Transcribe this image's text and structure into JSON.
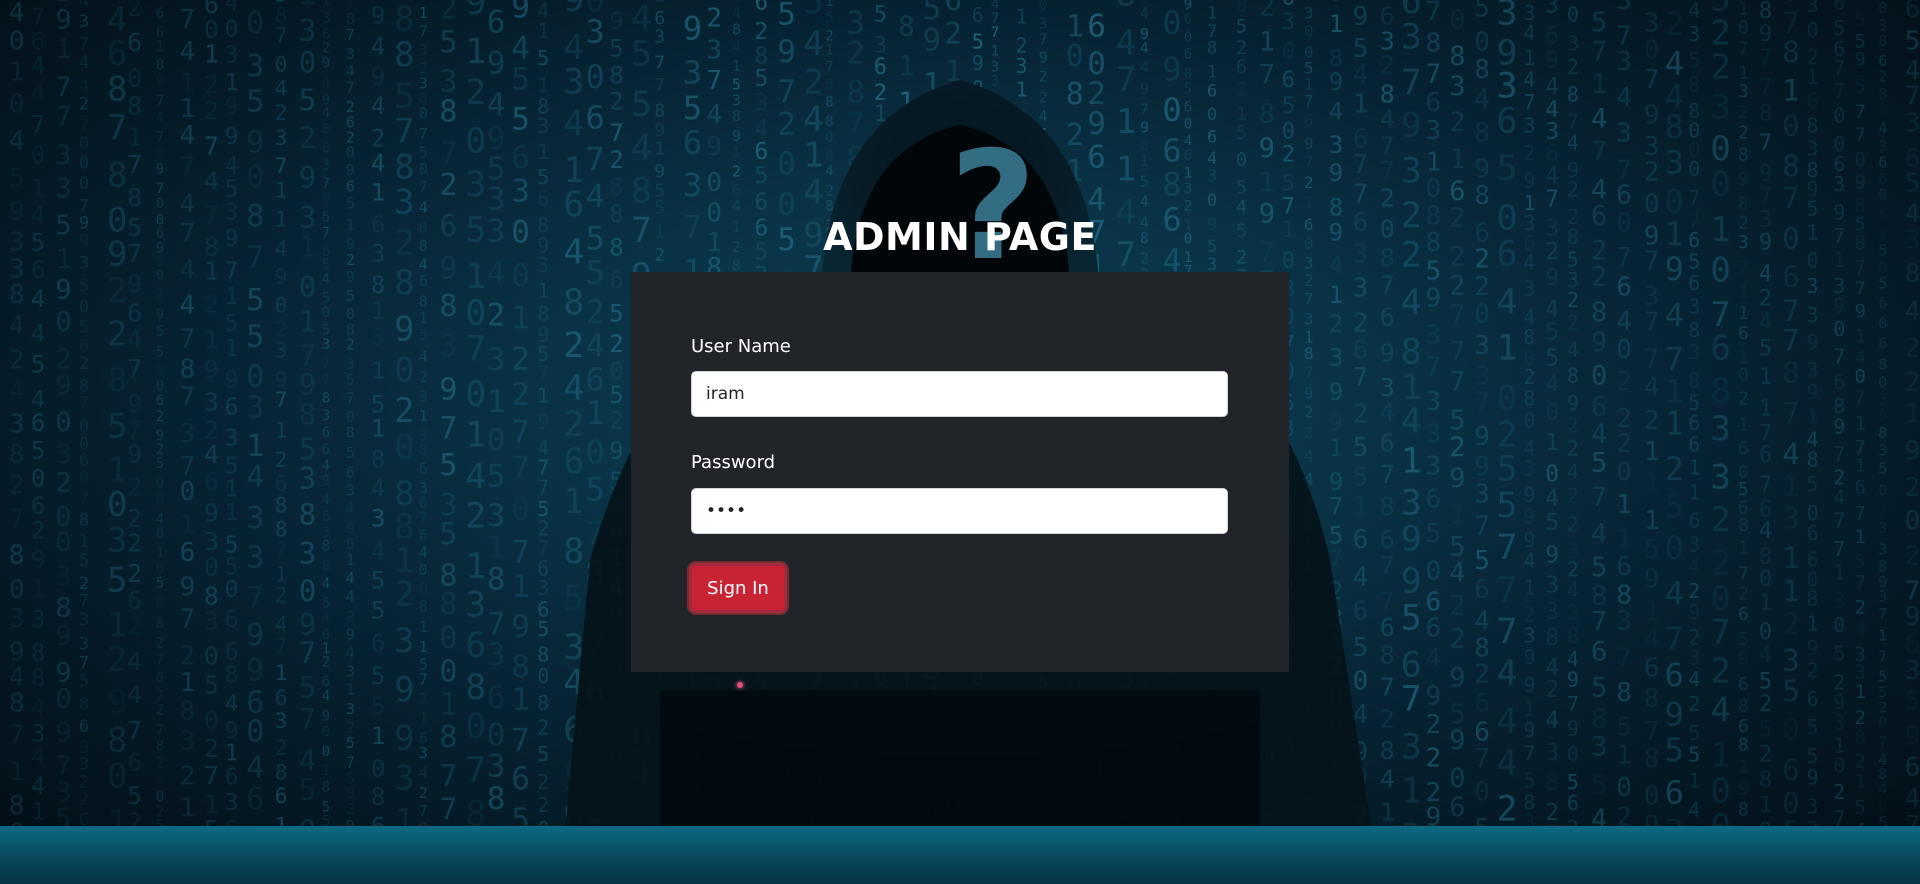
{
  "page": {
    "title": "ADMIN PAGE"
  },
  "form": {
    "username_label": "User Name",
    "username_value": "iram",
    "password_label": "Password",
    "password_value": "iram",
    "submit_label": "Sign In"
  },
  "colors": {
    "panel_bg": "#212529",
    "button_bg": "#c82333",
    "title": "#ffffff"
  },
  "icons": {
    "background": "hooded-hacker-matrix-background"
  }
}
